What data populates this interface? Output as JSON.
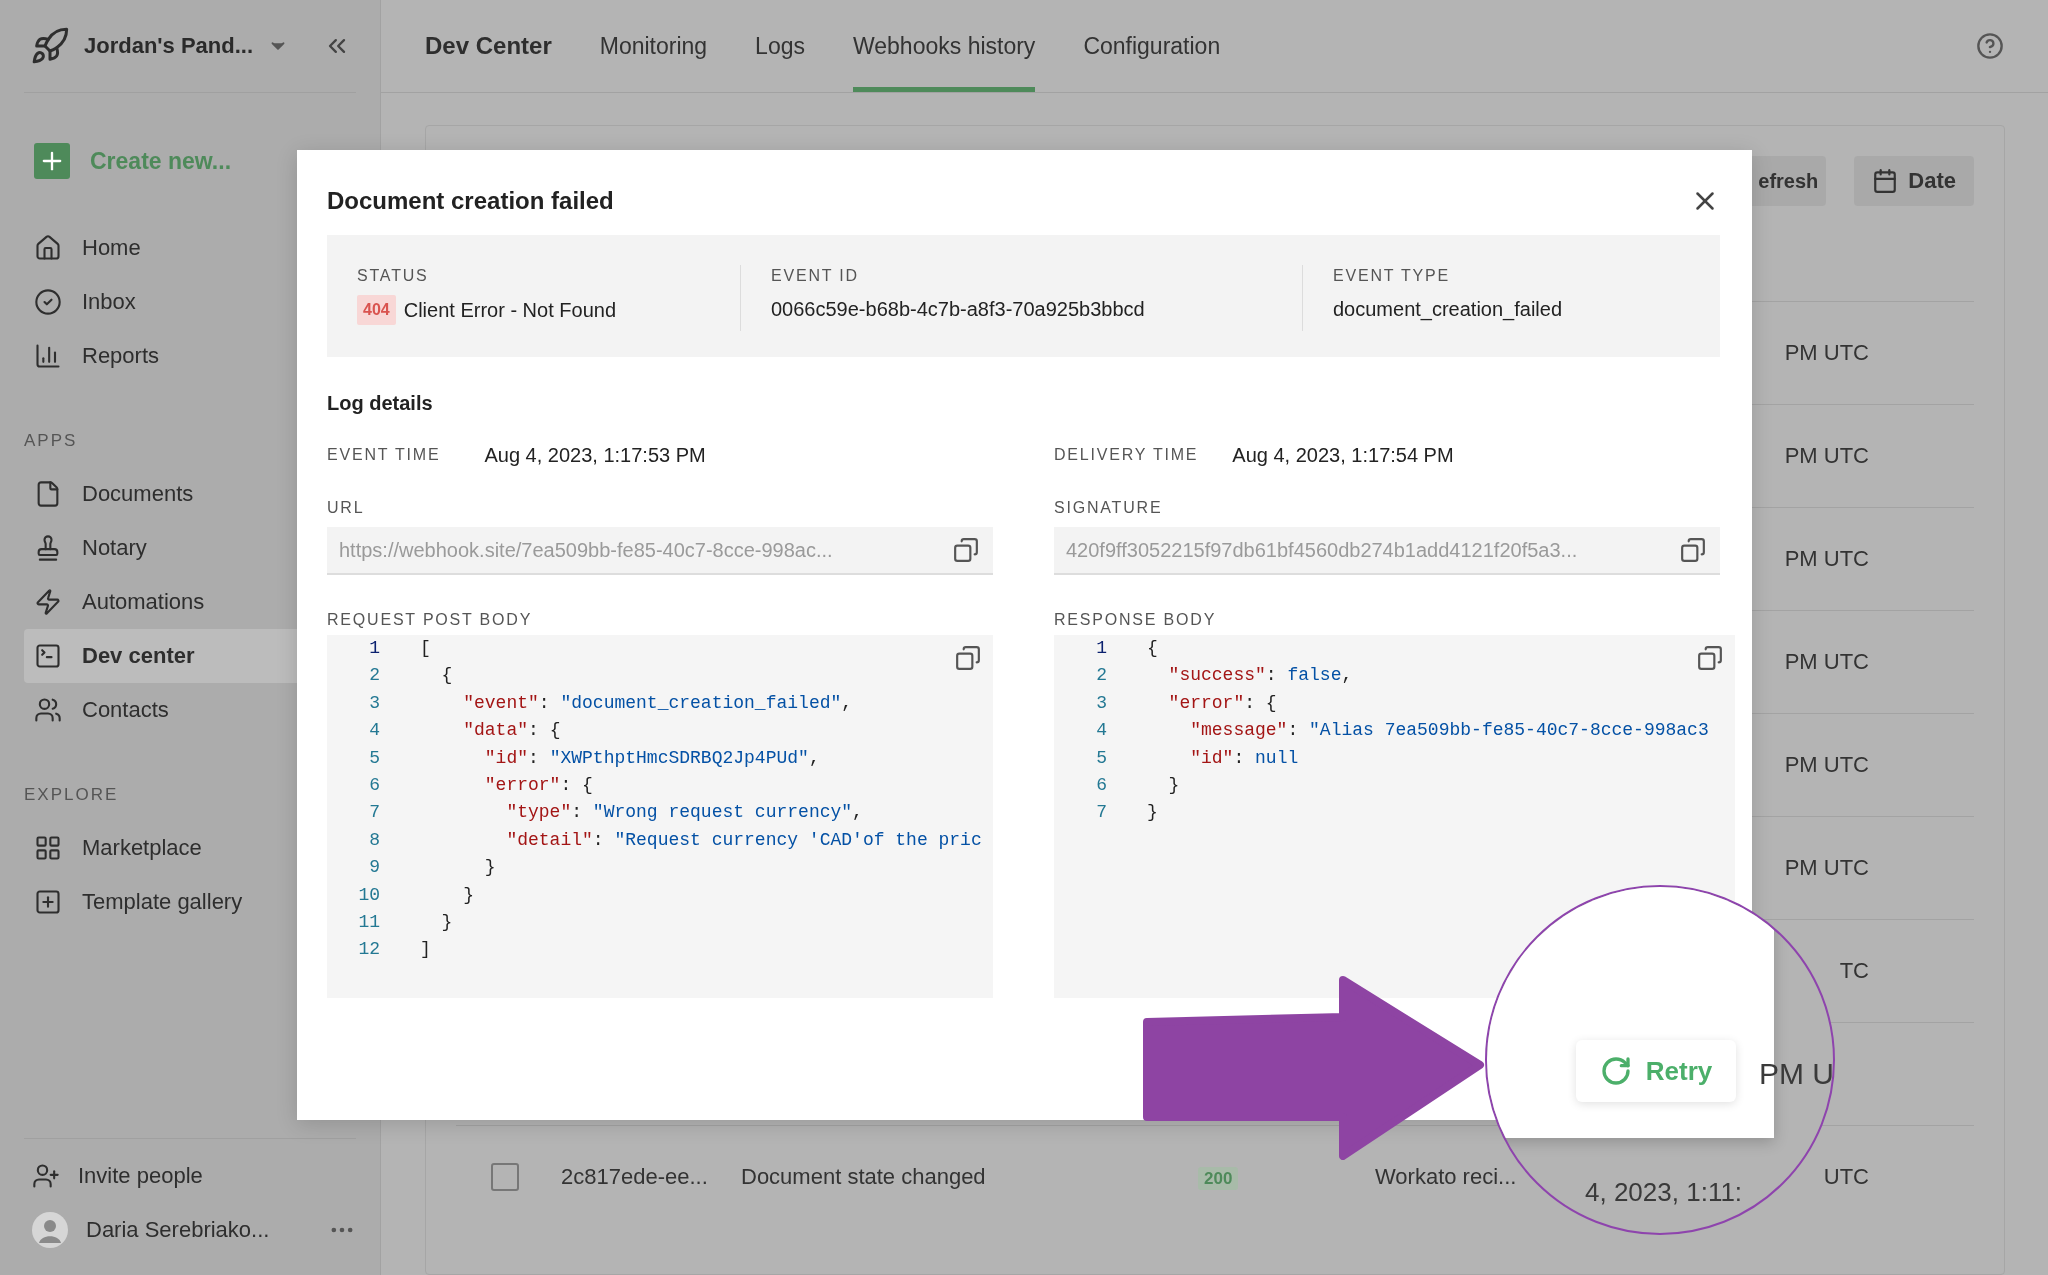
{
  "sidebar": {
    "workspace": "Jordan's Pand...",
    "create": "Create new...",
    "main_items": [
      {
        "label": "Home",
        "selected": false
      },
      {
        "label": "Inbox",
        "selected": false
      },
      {
        "label": "Reports",
        "selected": false
      }
    ],
    "sections": [
      {
        "heading": "APPS",
        "items": [
          {
            "label": "Documents",
            "selected": false
          },
          {
            "label": "Notary",
            "selected": false
          },
          {
            "label": "Automations",
            "selected": false
          },
          {
            "label": "Dev center",
            "selected": true
          },
          {
            "label": "Contacts",
            "selected": false
          }
        ]
      },
      {
        "heading": "EXPLORE",
        "items": [
          {
            "label": "Marketplace",
            "selected": false
          },
          {
            "label": "Template gallery",
            "selected": false
          }
        ]
      }
    ],
    "invite": "Invite people",
    "user": "Daria Serebriako..."
  },
  "topbar": {
    "title": "Dev Center",
    "tabs": [
      {
        "label": "Monitoring",
        "selected": false
      },
      {
        "label": "Logs",
        "selected": false
      },
      {
        "label": "Webhooks history",
        "selected": true
      },
      {
        "label": "Configuration",
        "selected": false
      }
    ]
  },
  "toolbar": {
    "refresh": "efresh",
    "date": "Date"
  },
  "rows": [
    {
      "kind": "time",
      "time": "PM UTC"
    },
    {
      "kind": "time",
      "time": "PM UTC"
    },
    {
      "kind": "time",
      "time": "PM UTC"
    },
    {
      "kind": "time",
      "time": "PM UTC"
    },
    {
      "kind": "time",
      "time": "PM UTC"
    },
    {
      "kind": "time",
      "time": "PM UTC"
    },
    {
      "kind": "time",
      "time": "TC"
    },
    {
      "kind": "covered"
    },
    {
      "kind": "full",
      "checked": false,
      "id": "2c817ede-ee...",
      "event": "Document state changed",
      "status": "200",
      "recipient": "Workato reci...",
      "time": "UTC"
    }
  ],
  "modal": {
    "title": "Document creation failed",
    "summary": [
      {
        "label": "STATUS",
        "badge": "404",
        "value": "Client Error - Not Found"
      },
      {
        "label": "EVENT ID",
        "value": "0066c59e-b68b-4c7b-a8f3-70a925b3bbcd"
      },
      {
        "label": "EVENT TYPE",
        "value": "document_creation_failed"
      }
    ],
    "section_title": "Log details",
    "times": [
      {
        "label": "EVENT TIME",
        "value": "Aug 4, 2023, 1:17:53 PM"
      },
      {
        "label": "DELIVERY TIME",
        "value": "Aug 4, 2023, 1:17:54 PM"
      }
    ],
    "fields": [
      {
        "label": "URL",
        "value": "https://webhook.site/7ea509bb-fe85-40c7-8cce-998ac..."
      },
      {
        "label": "SIGNATURE",
        "value": "420f9ff3052215f97db61bf4560db274b1add4121f20f5a3..."
      }
    ],
    "bodies": [
      {
        "label": "REQUEST POST BODY",
        "lines": [
          {
            "num": "1",
            "current": true,
            "tokens": [
              {
                "kind": "punct",
                "text": "["
              }
            ]
          },
          {
            "num": "2",
            "current": false,
            "tokens": [
              {
                "kind": "punct",
                "text": "  {"
              }
            ]
          },
          {
            "num": "3",
            "current": false,
            "tokens": [
              {
                "kind": "key",
                "text": "    \"event\""
              },
              {
                "kind": "punct",
                "text": ": "
              },
              {
                "kind": "string",
                "text": "\"document_creation_failed\""
              },
              {
                "kind": "punct",
                "text": ","
              }
            ]
          },
          {
            "num": "4",
            "current": false,
            "tokens": [
              {
                "kind": "key",
                "text": "    \"data\""
              },
              {
                "kind": "punct",
                "text": ": {"
              }
            ]
          },
          {
            "num": "5",
            "current": false,
            "tokens": [
              {
                "kind": "key",
                "text": "      \"id\""
              },
              {
                "kind": "punct",
                "text": ": "
              },
              {
                "kind": "string",
                "text": "\"XWPthptHmcSDRBQ2Jp4PUd\""
              },
              {
                "kind": "punct",
                "text": ","
              }
            ]
          },
          {
            "num": "6",
            "current": false,
            "tokens": [
              {
                "kind": "key",
                "text": "      \"error\""
              },
              {
                "kind": "punct",
                "text": ": {"
              }
            ]
          },
          {
            "num": "7",
            "current": false,
            "tokens": [
              {
                "kind": "key",
                "text": "        \"type\""
              },
              {
                "kind": "punct",
                "text": ": "
              },
              {
                "kind": "string",
                "text": "\"Wrong request currency\""
              },
              {
                "kind": "punct",
                "text": ","
              }
            ]
          },
          {
            "num": "8",
            "current": false,
            "tokens": [
              {
                "kind": "key",
                "text": "        \"detail\""
              },
              {
                "kind": "punct",
                "text": ": "
              },
              {
                "kind": "string",
                "text": "\"Request currency 'CAD'of the pric"
              }
            ]
          },
          {
            "num": "9",
            "current": false,
            "tokens": [
              {
                "kind": "punct",
                "text": "      }"
              }
            ]
          },
          {
            "num": "10",
            "current": false,
            "tokens": [
              {
                "kind": "punct",
                "text": "    }"
              }
            ]
          },
          {
            "num": "11",
            "current": false,
            "tokens": [
              {
                "kind": "punct",
                "text": "  }"
              }
            ]
          },
          {
            "num": "12",
            "current": false,
            "tokens": [
              {
                "kind": "punct",
                "text": "]"
              }
            ]
          }
        ]
      },
      {
        "label": "RESPONSE BODY",
        "lines": [
          {
            "num": "1",
            "current": true,
            "tokens": [
              {
                "kind": "punct",
                "text": "{"
              }
            ]
          },
          {
            "num": "2",
            "current": false,
            "tokens": [
              {
                "kind": "key",
                "text": "  \"success\""
              },
              {
                "kind": "punct",
                "text": ": "
              },
              {
                "kind": "literal",
                "text": "false"
              },
              {
                "kind": "punct",
                "text": ","
              }
            ]
          },
          {
            "num": "3",
            "current": false,
            "tokens": [
              {
                "kind": "key",
                "text": "  \"error\""
              },
              {
                "kind": "punct",
                "text": ": {"
              }
            ]
          },
          {
            "num": "4",
            "current": false,
            "tokens": [
              {
                "kind": "key",
                "text": "    \"message\""
              },
              {
                "kind": "punct",
                "text": ": "
              },
              {
                "kind": "string",
                "text": "\"Alias 7ea509bb-fe85-40c7-8cce-998ac3"
              }
            ]
          },
          {
            "num": "5",
            "current": false,
            "tokens": [
              {
                "kind": "key",
                "text": "    \"id\""
              },
              {
                "kind": "punct",
                "text": ": "
              },
              {
                "kind": "literal",
                "text": "null"
              }
            ]
          },
          {
            "num": "6",
            "current": false,
            "tokens": [
              {
                "kind": "punct",
                "text": "  }"
              }
            ]
          },
          {
            "num": "7",
            "current": false,
            "tokens": [
              {
                "kind": "punct",
                "text": "}"
              }
            ]
          }
        ]
      }
    ]
  },
  "magnifier": {
    "button": "Retry",
    "row_time": "PM U",
    "row_date": "4, 2023, 1:11:"
  }
}
